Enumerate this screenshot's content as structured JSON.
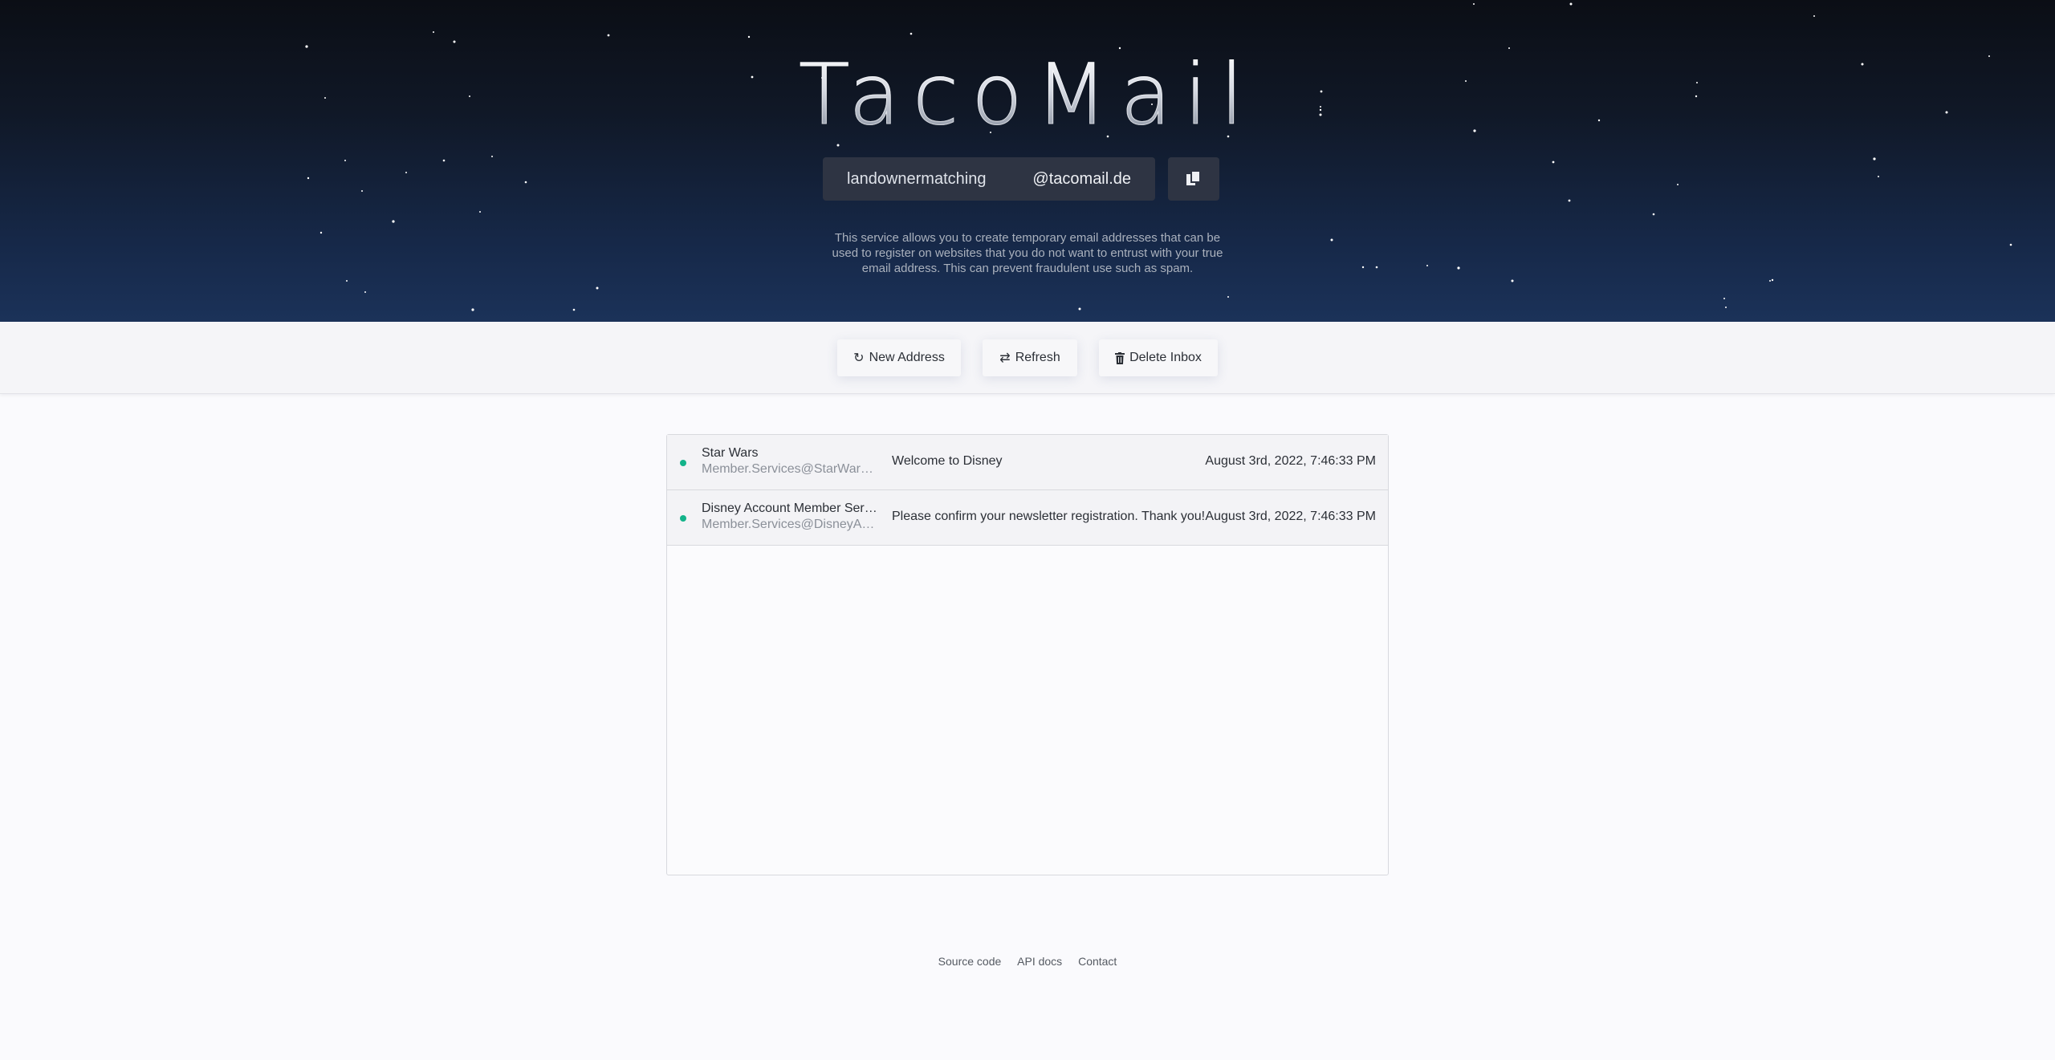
{
  "app": {
    "logo": "TacoMail"
  },
  "address": {
    "username": "landownermatching",
    "domain": "@tacomail.de",
    "copy_icon": "copy-icon"
  },
  "description": "This service allows you to create temporary email addresses that can be used to register on websites that you do not want to entrust with your true email address. This can prevent fraudulent use such as spam.",
  "toolbar": {
    "new_address_label": "New Address",
    "new_address_icon": "rotate-icon",
    "refresh_label": "Refresh",
    "refresh_icon": "sync-icon",
    "delete_label": "Delete Inbox",
    "delete_icon": "trash-icon"
  },
  "mails": [
    {
      "sender_name": "Star Wars",
      "sender_email": "Member.Services@StarWars.com",
      "subject": "Welcome to Disney",
      "date": "August 3rd, 2022, 7:46:33 PM",
      "unread": true
    },
    {
      "sender_name": "Disney Account Member Services",
      "sender_email": "Member.Services@DisneyAccount.com",
      "subject": "Please confirm your newsletter registration. Thank you!",
      "date": "August 3rd, 2022, 7:46:33 PM",
      "unread": true
    }
  ],
  "footer": {
    "links": [
      "Source code",
      "API docs",
      "Contact"
    ]
  },
  "colors": {
    "unread_dot": "#13b38a",
    "hero_top": "#0b0e15",
    "hero_bottom": "#1b3259"
  }
}
